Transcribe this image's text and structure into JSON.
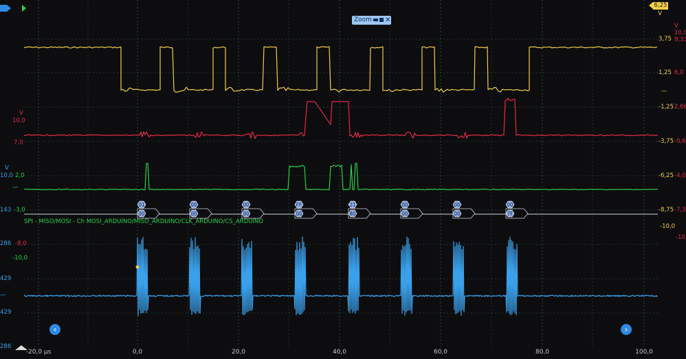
{
  "zoom": {
    "label": "Zoom"
  },
  "top_right_scale": {
    "value": "6,25",
    "unit": "V"
  },
  "decoder": {
    "title": "SPI - MISO/MOSI - Ch MOSI_ARDUINO/MISO_ARDUINO/CLK_ARDUINO/CS_ARDUINO",
    "frames": [
      {
        "top": "01",
        "bottom": "00"
      },
      {
        "top": "00",
        "bottom": "00"
      },
      {
        "top": "00",
        "bottom": "00"
      },
      {
        "top": "FF",
        "bottom": "00"
      },
      {
        "top": "21",
        "bottom": "80"
      },
      {
        "top": "00",
        "bottom": "00"
      },
      {
        "top": "00",
        "bottom": "00"
      },
      {
        "top": "00",
        "bottom": "7F"
      }
    ]
  },
  "x_axis": {
    "labels": [
      "-20,0 µs",
      "0,0",
      "20,0",
      "40,0",
      "60,0",
      "80,0",
      "100,0"
    ]
  },
  "right_axis_yellow": [
    "3,75",
    "1,25",
    "-1,25",
    "-3,75",
    "-6,25",
    "-8,75",
    "-10,0"
  ],
  "right_axis_red": {
    "unit": "V",
    "top": "10,0",
    "values": [
      "9,333",
      "6,0",
      "2,667",
      "-0,667",
      "-4,0",
      "-7,333",
      "-10,0"
    ]
  },
  "left_axis_red": {
    "unit": "V",
    "values": [
      "10,0",
      "7,0"
    ]
  },
  "left_axis_green": {
    "unit": "V",
    "values": [
      "10,0",
      "2,0",
      "-3,0"
    ]
  },
  "left_axis_blue": {
    "values": [
      "-8,0",
      "-10,0"
    ]
  },
  "left_edge_fragments": [
    "143",
    "286",
    "429",
    "429",
    "286"
  ],
  "colors": {
    "background": "#0d0d0f",
    "grid": "#27503c",
    "yellow": "#f2cf48",
    "red": "#e52a48",
    "green": "#28d24a",
    "blue": "#3aa0ea",
    "decoder_bubble": "#8fa9e3"
  },
  "icons": [
    "chevron-left-icon",
    "chevron-right-icon",
    "minimize-icon",
    "maximize-icon",
    "close-icon"
  ]
}
